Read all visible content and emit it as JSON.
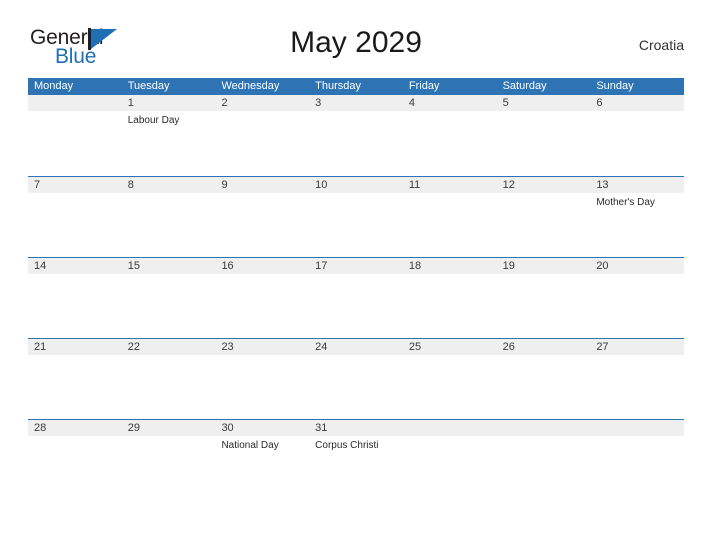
{
  "brand": {
    "name_part1": "General",
    "name_part2": "Blue",
    "mark": "triangle-logo"
  },
  "header": {
    "title": "May 2029",
    "country": "Croatia"
  },
  "colors": {
    "header_blue": "#2e74b5",
    "band_gray": "#efefef",
    "logo_blue": "#1f6fb2",
    "text_dark": "#231f20"
  },
  "calendar": {
    "weekdays": [
      "Monday",
      "Tuesday",
      "Wednesday",
      "Thursday",
      "Friday",
      "Saturday",
      "Sunday"
    ],
    "weeks": [
      [
        {
          "day": "",
          "events": []
        },
        {
          "day": "1",
          "events": [
            "Labour Day"
          ]
        },
        {
          "day": "2",
          "events": []
        },
        {
          "day": "3",
          "events": []
        },
        {
          "day": "4",
          "events": []
        },
        {
          "day": "5",
          "events": []
        },
        {
          "day": "6",
          "events": []
        }
      ],
      [
        {
          "day": "7",
          "events": []
        },
        {
          "day": "8",
          "events": []
        },
        {
          "day": "9",
          "events": []
        },
        {
          "day": "10",
          "events": []
        },
        {
          "day": "11",
          "events": []
        },
        {
          "day": "12",
          "events": []
        },
        {
          "day": "13",
          "events": [
            "Mother's Day"
          ]
        }
      ],
      [
        {
          "day": "14",
          "events": []
        },
        {
          "day": "15",
          "events": []
        },
        {
          "day": "16",
          "events": []
        },
        {
          "day": "17",
          "events": []
        },
        {
          "day": "18",
          "events": []
        },
        {
          "day": "19",
          "events": []
        },
        {
          "day": "20",
          "events": []
        }
      ],
      [
        {
          "day": "21",
          "events": []
        },
        {
          "day": "22",
          "events": []
        },
        {
          "day": "23",
          "events": []
        },
        {
          "day": "24",
          "events": []
        },
        {
          "day": "25",
          "events": []
        },
        {
          "day": "26",
          "events": []
        },
        {
          "day": "27",
          "events": []
        }
      ],
      [
        {
          "day": "28",
          "events": []
        },
        {
          "day": "29",
          "events": []
        },
        {
          "day": "30",
          "events": [
            "National Day"
          ]
        },
        {
          "day": "31",
          "events": [
            "Corpus Christi"
          ]
        },
        {
          "day": "",
          "events": []
        },
        {
          "day": "",
          "events": []
        },
        {
          "day": "",
          "events": []
        }
      ]
    ]
  }
}
